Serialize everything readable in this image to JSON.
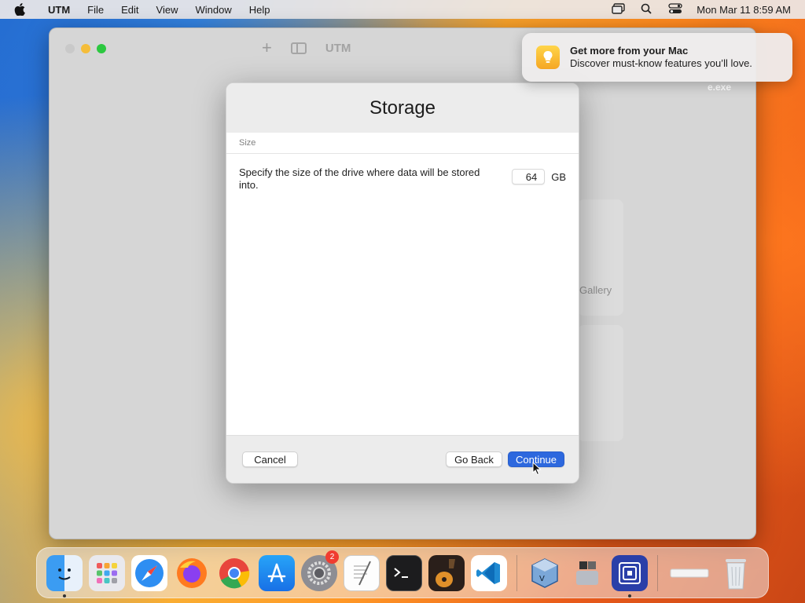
{
  "menubar": {
    "app": "UTM",
    "items": [
      "File",
      "Edit",
      "View",
      "Window",
      "Help"
    ],
    "datetime": "Mon Mar 11  8:59 AM"
  },
  "utm_window": {
    "title": "UTM",
    "gallery_text": "Gallery",
    "exe_text": "e.exe"
  },
  "dialog": {
    "title": "Storage",
    "section_label": "Size",
    "description": "Specify the size of the drive where data will be stored into.",
    "size_value": "64",
    "size_unit": "GB",
    "buttons": {
      "cancel": "Cancel",
      "go_back": "Go Back",
      "continue": "Continue"
    }
  },
  "notification": {
    "title": "Get more from your Mac",
    "body": "Discover must-know features you’ll love.",
    "icon": "lightbulb-icon"
  },
  "dock": {
    "settings_badge": "2",
    "colors": {
      "accent": "#2d68de"
    }
  }
}
